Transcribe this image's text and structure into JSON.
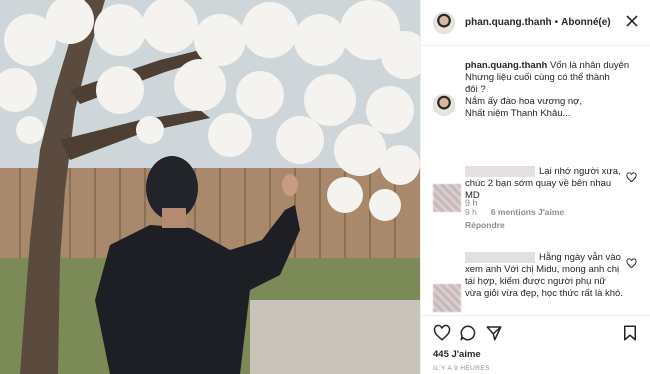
{
  "post": {
    "username": "phan.quang.thanh",
    "dot": "•",
    "follow_status": "Abonné(e)"
  },
  "caption": {
    "username": "phan.quang.thanh",
    "lines": [
      "Vốn là nhân duyên",
      "Nhưng liệu cuối cùng có thể thành",
      "đôi ?",
      "Nắm ấy đào hoa vương nợ,",
      "Nhất niệm Thanh Khâu..."
    ],
    "time": "9 h"
  },
  "comments": [
    {
      "text": "Lại nhớ người xưa, chúc 2 bạn sớm quay về bên nhau MD",
      "time": "9 h",
      "likes": "6 mentions J'aime",
      "reply": "Répondre"
    },
    {
      "text": "Hằng ngày vẫn vào xem anh Với chị Midu, mong anh chị tái hợp, kiếm được người phụ nữ vừa giỏi vừa đẹp, học thức rất là khó."
    }
  ],
  "footer": {
    "likes": "445 J'aime",
    "ago": "IL Y A 9 HEURES"
  },
  "icons": {
    "close": "close-icon",
    "heart": "heart-icon",
    "comment": "comment-icon",
    "share": "share-icon",
    "bookmark": "bookmark-icon"
  }
}
